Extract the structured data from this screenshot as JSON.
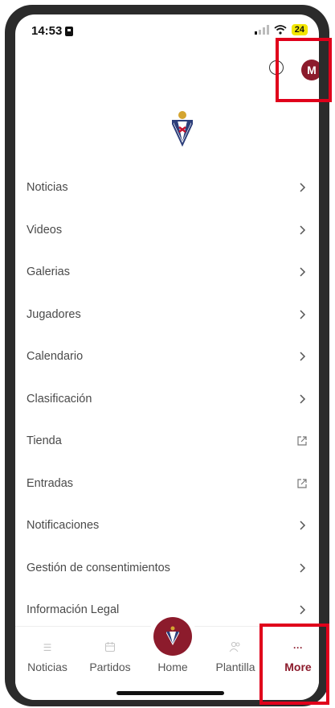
{
  "status_bar": {
    "time": "14:53",
    "battery": "24"
  },
  "header": {
    "avatar_initial": "M"
  },
  "menu": {
    "items": [
      {
        "label": "Noticias",
        "icon": "chevron-right-icon"
      },
      {
        "label": "Videos",
        "icon": "chevron-right-icon"
      },
      {
        "label": "Galerias",
        "icon": "chevron-right-icon"
      },
      {
        "label": "Jugadores",
        "icon": "chevron-right-icon"
      },
      {
        "label": "Calendario",
        "icon": "chevron-right-icon"
      },
      {
        "label": "Clasificación",
        "icon": "chevron-right-icon"
      },
      {
        "label": "Tienda",
        "icon": "external-link-icon"
      },
      {
        "label": "Entradas",
        "icon": "external-link-icon"
      },
      {
        "label": "Notificaciones",
        "icon": "chevron-right-icon"
      },
      {
        "label": "Gestión de consentimientos",
        "icon": "chevron-right-icon"
      },
      {
        "label": "Información Legal",
        "icon": "chevron-right-icon"
      }
    ]
  },
  "bottom_nav": {
    "noticias": "Noticias",
    "partidos": "Partidos",
    "home": "Home",
    "plantilla": "Plantilla",
    "more": "More",
    "more_icon": "···"
  },
  "colors": {
    "brand": "#8c1b2c",
    "highlight": "#e0001b"
  }
}
